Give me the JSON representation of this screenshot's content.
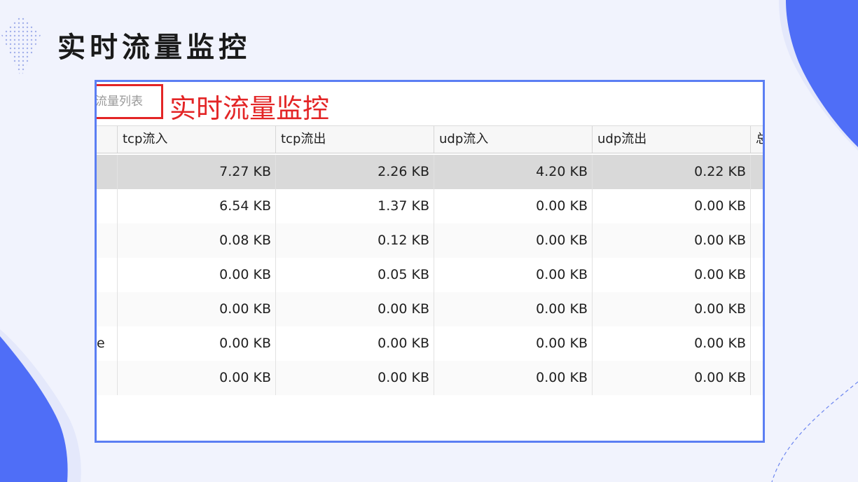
{
  "slide": {
    "title": "实时流量监控",
    "colors": {
      "accent": "#4f6ef7",
      "background": "#f1f3fd",
      "frame": "#5b7ef3"
    }
  },
  "screenshot": {
    "tab_label": "流量列表",
    "annotation": "实时流量监控",
    "annotation_color": "#e32526",
    "columns": [
      "tcp流入",
      "tcp流出",
      "udp流入",
      "udp流出",
      "总"
    ],
    "rows": [
      {
        "name": "",
        "tcp_in": "7.27 KB",
        "tcp_out": "2.26 KB",
        "udp_in": "4.20 KB",
        "udp_out": "0.22 KB",
        "selected": true
      },
      {
        "name": "",
        "tcp_in": "6.54 KB",
        "tcp_out": "1.37 KB",
        "udp_in": "0.00 KB",
        "udp_out": "0.00 KB"
      },
      {
        "name": "",
        "tcp_in": "0.08 KB",
        "tcp_out": "0.12 KB",
        "udp_in": "0.00 KB",
        "udp_out": "0.00 KB"
      },
      {
        "name": "",
        "tcp_in": "0.00 KB",
        "tcp_out": "0.05 KB",
        "udp_in": "0.00 KB",
        "udp_out": "0.00 KB"
      },
      {
        "name": "",
        "tcp_in": "0.00 KB",
        "tcp_out": "0.00 KB",
        "udp_in": "0.00 KB",
        "udp_out": "0.00 KB"
      },
      {
        "name": "e",
        "tcp_in": "0.00 KB",
        "tcp_out": "0.00 KB",
        "udp_in": "0.00 KB",
        "udp_out": "0.00 KB"
      },
      {
        "name": "",
        "tcp_in": "0.00 KB",
        "tcp_out": "0.00 KB",
        "udp_in": "0.00 KB",
        "udp_out": "0.00 KB"
      }
    ]
  }
}
